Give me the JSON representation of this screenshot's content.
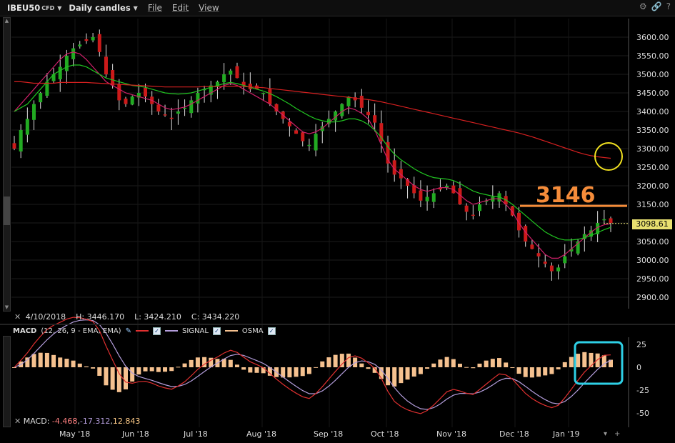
{
  "toolbar": {
    "symbol": "IBEU50",
    "symbol_suffix": "CFD",
    "timeframe": "Daily candles",
    "menu_file": "File",
    "menu_edit": "Edit",
    "menu_view": "View"
  },
  "info": {
    "date": "4/10/2018",
    "high": "H: 3446.170",
    "low": "L: 3424.210",
    "close": "C: 3434.220"
  },
  "price_panel": {
    "current_price": "3098.61",
    "annotation_level": "3146",
    "y_ticks": [
      "3600.00",
      "3550.00",
      "3500.00",
      "3450.00",
      "3400.00",
      "3350.00",
      "3300.00",
      "3250.00",
      "3200.00",
      "3150.00",
      "3100.00",
      "3050.00",
      "3000.00",
      "2950.00",
      "2900.00"
    ],
    "colors": {
      "up": "#22aa22",
      "down": "#cc1a1a",
      "ema_fast": "#d0206a",
      "ema_mid": "#21c421",
      "ema_slow": "#d62020",
      "annotation": "#f58c3a",
      "circle": "#f0e020"
    }
  },
  "macd_panel": {
    "title": "MACD",
    "params": "(12, 26, 9 - EMA, EMA)",
    "signal_label": "SIGNAL",
    "osma_label": "OSMA",
    "values_label": "MACD:",
    "value_macd": "-4.468",
    "value_signal": "-17.312",
    "value_osma": "12.843",
    "y_ticks": [
      "25",
      "0",
      "-25",
      "-50"
    ],
    "colors": {
      "macd": "#e03030",
      "signal": "#b39ddb",
      "osma": "#f5c18f",
      "highlight": "#2ed0e6"
    }
  },
  "x_axis": {
    "labels": [
      "May '18",
      "Jun '18",
      "Jul '18",
      "Aug '18",
      "Sep '18",
      "Oct '18",
      "Nov '18",
      "Dec '18",
      "Jan '19"
    ]
  },
  "chart_data": {
    "type": "candlestick",
    "xlabel": "",
    "ylabel": "",
    "ylim": [
      2880,
      3620
    ],
    "series": [
      {
        "name": "price",
        "values": [
          3300,
          3350,
          3380,
          3420,
          3450,
          3480,
          3500,
          3520,
          3550,
          3570,
          3580,
          3590,
          3600,
          3560,
          3500,
          3470,
          3430,
          3420,
          3440,
          3450,
          3440,
          3420,
          3400,
          3390,
          3380,
          3400,
          3410,
          3430,
          3450,
          3460,
          3470,
          3480,
          3500,
          3510,
          3490,
          3470,
          3460,
          3460,
          3450,
          3420,
          3400,
          3380,
          3360,
          3340,
          3320,
          3310,
          3340,
          3360,
          3380,
          3400,
          3420,
          3440,
          3430,
          3410,
          3390,
          3370,
          3320,
          3260,
          3230,
          3220,
          3200,
          3180,
          3160,
          3170,
          3180,
          3190,
          3200,
          3180,
          3150,
          3130,
          3120,
          3150,
          3160,
          3170,
          3180,
          3150,
          3120,
          3080,
          3050,
          3030,
          3010,
          2990,
          2970,
          2980,
          3010,
          3030,
          3050,
          3070,
          3080,
          3100,
          3110,
          3100
        ]
      },
      {
        "name": "",
        "values": [
          3400,
          3420,
          3440,
          3460,
          3480,
          3500,
          3520,
          3540,
          3555,
          3560,
          3555,
          3540,
          3520,
          3500,
          3480,
          3470,
          3460,
          3450,
          3445,
          3440,
          3435,
          3430,
          3420,
          3410,
          3405,
          3408,
          3412,
          3420,
          3430,
          3440,
          3450,
          3460,
          3470,
          3475,
          3470,
          3460,
          3450,
          3440,
          3430,
          3420,
          3405,
          3390,
          3375,
          3360,
          3345,
          3340,
          3345,
          3355,
          3370,
          3385,
          3400,
          3410,
          3405,
          3395,
          3380,
          3350,
          3310,
          3270,
          3245,
          3230,
          3215,
          3200,
          3190,
          3185,
          3190,
          3195,
          3195,
          3190,
          3175,
          3160,
          3150,
          3155,
          3160,
          3165,
          3165,
          3150,
          3130,
          3100,
          3075,
          3055,
          3035,
          3015,
          3005,
          3005,
          3015,
          3030,
          3045,
          3060,
          3075,
          3088,
          3095,
          3098
        ]
      },
      {
        "name": "",
        "values": [
          3400,
          3410,
          3420,
          3440,
          3460,
          3480,
          3500,
          3510,
          3520,
          3525,
          3525,
          3520,
          3510,
          3500,
          3490,
          3485,
          3480,
          3475,
          3470,
          3468,
          3465,
          3460,
          3455,
          3450,
          3448,
          3447,
          3448,
          3450,
          3455,
          3460,
          3465,
          3470,
          3475,
          3478,
          3475,
          3470,
          3465,
          3460,
          3455,
          3448,
          3440,
          3430,
          3420,
          3408,
          3398,
          3388,
          3380,
          3375,
          3372,
          3372,
          3375,
          3380,
          3380,
          3375,
          3365,
          3350,
          3330,
          3305,
          3285,
          3270,
          3258,
          3246,
          3236,
          3228,
          3222,
          3220,
          3218,
          3214,
          3206,
          3196,
          3186,
          3180,
          3176,
          3172,
          3170,
          3162,
          3150,
          3135,
          3120,
          3105,
          3090,
          3076,
          3066,
          3058,
          3054,
          3054,
          3056,
          3060,
          3066,
          3074,
          3082,
          3088
        ]
      },
      {
        "name": "",
        "values": [
          3480,
          3480,
          3478,
          3476,
          3476,
          3476,
          3476,
          3478,
          3478,
          3478,
          3478,
          3478,
          3477,
          3476,
          3475,
          3474,
          3473,
          3472,
          3471,
          3470,
          3469,
          3468,
          3467,
          3466,
          3466,
          3466,
          3466,
          3466,
          3466,
          3467,
          3467,
          3467,
          3468,
          3468,
          3468,
          3467,
          3466,
          3465,
          3464,
          3462,
          3460,
          3458,
          3456,
          3454,
          3452,
          3450,
          3448,
          3446,
          3444,
          3442,
          3440,
          3438,
          3436,
          3434,
          3432,
          3429,
          3426,
          3422,
          3418,
          3414,
          3410,
          3406,
          3402,
          3398,
          3394,
          3390,
          3386,
          3382,
          3378,
          3374,
          3370,
          3366,
          3362,
          3358,
          3354,
          3350,
          3346,
          3342,
          3337,
          3332,
          3326,
          3320,
          3314,
          3308,
          3302,
          3296,
          3290,
          3285,
          3281,
          3278,
          3276,
          3274
        ]
      }
    ]
  }
}
